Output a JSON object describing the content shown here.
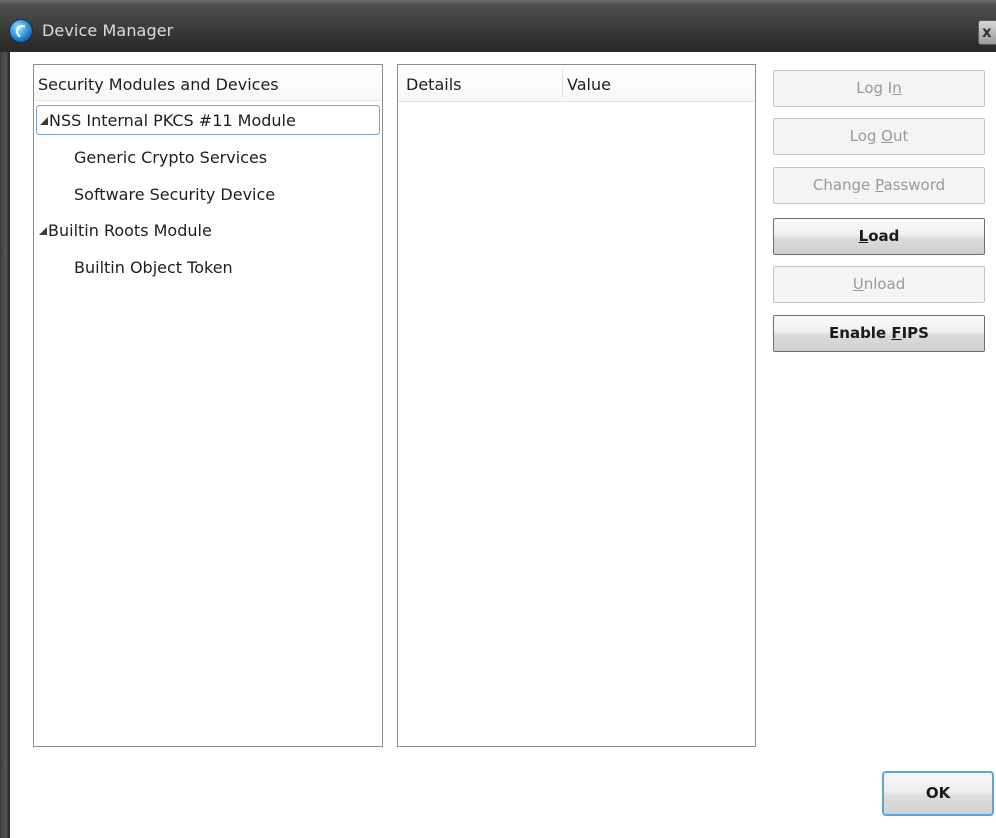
{
  "window": {
    "title": "Device Manager",
    "close_label": "x"
  },
  "tree": {
    "header": "Security Modules and Devices",
    "items": [
      {
        "label": "NSS Internal PKCS #11 Module",
        "level": 0,
        "expanded": true,
        "selected": true
      },
      {
        "label": "Generic Crypto Services",
        "level": 1
      },
      {
        "label": "Software Security Device",
        "level": 1
      },
      {
        "label": "Builtin Roots Module",
        "level": 0,
        "expanded": true
      },
      {
        "label": "Builtin Object Token",
        "level": 1
      }
    ]
  },
  "details": {
    "columns": [
      "Details",
      "Value"
    ],
    "rows": []
  },
  "buttons": {
    "log_in": {
      "pre": "Log I",
      "accel": "n",
      "post": "",
      "enabled": false
    },
    "log_out": {
      "pre": "Log ",
      "accel": "O",
      "post": "ut",
      "enabled": false
    },
    "change_password": {
      "pre": "Change ",
      "accel": "P",
      "post": "assword",
      "enabled": false
    },
    "load": {
      "pre": "",
      "accel": "L",
      "post": "oad",
      "enabled": true
    },
    "unload": {
      "pre": "",
      "accel": "U",
      "post": "nload",
      "enabled": false
    },
    "enable_fips": {
      "pre": "Enable ",
      "accel": "F",
      "post": "IPS",
      "enabled": true
    },
    "ok": "OK"
  },
  "colors": {
    "focus_border": "#5aa6d6",
    "selection_border": "#7da2ce",
    "disabled_text": "#9a9a9a"
  }
}
